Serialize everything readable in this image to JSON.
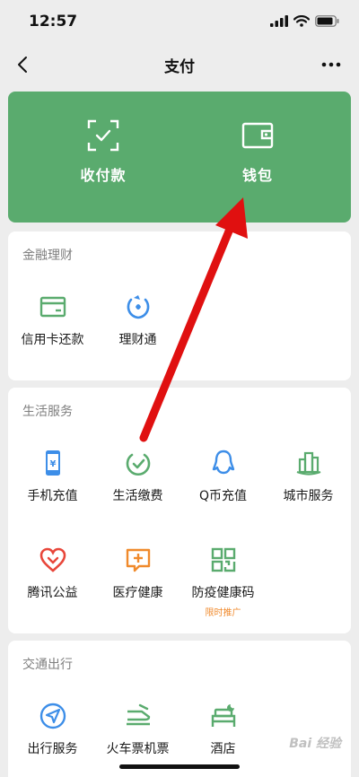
{
  "status": {
    "time": "12:57"
  },
  "nav": {
    "title": "支付"
  },
  "top_card": {
    "items": [
      {
        "label": "收付款",
        "icon": "scan-pay-icon"
      },
      {
        "label": "钱包",
        "icon": "wallet-icon"
      }
    ],
    "background": "#5aab6e"
  },
  "sections": [
    {
      "title": "金融理财",
      "items": [
        {
          "label": "信用卡还款",
          "icon": "credit-card-icon"
        },
        {
          "label": "理财通",
          "icon": "wealth-icon"
        }
      ]
    },
    {
      "title": "生活服务",
      "items": [
        {
          "label": "手机充值",
          "icon": "phone-topup-icon"
        },
        {
          "label": "生活缴费",
          "icon": "utility-bill-icon"
        },
        {
          "label": "Q币充值",
          "icon": "qq-coin-icon"
        },
        {
          "label": "城市服务",
          "icon": "city-service-icon"
        },
        {
          "label": "腾讯公益",
          "icon": "charity-heart-icon"
        },
        {
          "label": "医疗健康",
          "icon": "medical-icon"
        },
        {
          "label": "防疫健康码",
          "icon": "qr-code-icon",
          "badge": "限时推广"
        }
      ]
    },
    {
      "title": "交通出行",
      "items": [
        {
          "label": "出行服务",
          "icon": "navigation-icon"
        },
        {
          "label": "火车票机票",
          "icon": "train-plane-icon"
        },
        {
          "label": "酒店",
          "icon": "hotel-icon"
        }
      ]
    }
  ],
  "watermark": "Bai 经验",
  "colors": {
    "green": "#5aab6e",
    "blue": "#3d8ee8",
    "orange": "#f08a2c",
    "red": "#e8463a",
    "arrow": "#e01010"
  }
}
